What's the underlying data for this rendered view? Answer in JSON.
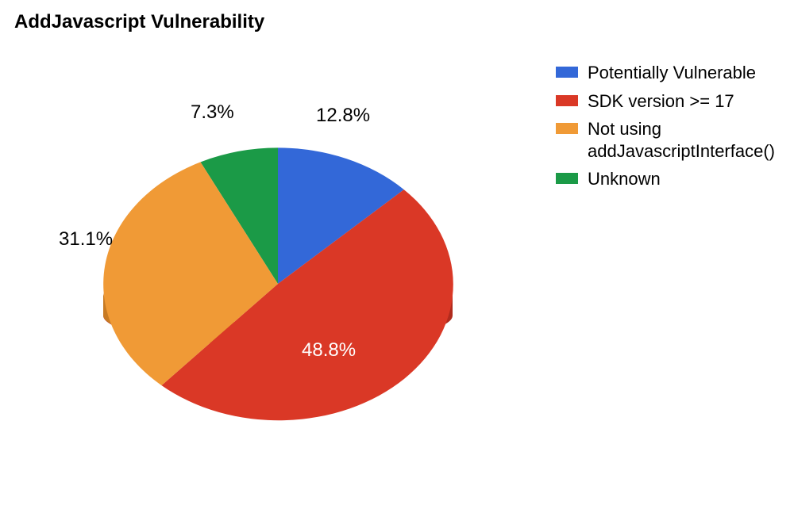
{
  "title": "AddJavascript Vulnerability",
  "legend": [
    {
      "label": "Potentially Vulnerable",
      "color": "#3368d8"
    },
    {
      "label": "SDK version >= 17",
      "color": "#da3826"
    },
    {
      "label": "Not using addJavascriptInterface()",
      "color": "#f09a36"
    },
    {
      "label": "Unknown",
      "color": "#1b9a47"
    }
  ],
  "slice_labels": {
    "potentially_vulnerable": "12.8%",
    "sdk_17": "48.8%",
    "not_using": "31.1%",
    "unknown": "7.3%"
  },
  "chart_data": {
    "type": "pie",
    "title": "AddJavascript Vulnerability",
    "categories": [
      "Potentially Vulnerable",
      "SDK version >= 17",
      "Not using addJavascriptInterface()",
      "Unknown"
    ],
    "values": [
      12.8,
      48.8,
      31.1,
      7.3
    ],
    "colors": [
      "#3368d8",
      "#da3826",
      "#f09a36",
      "#1b9a47"
    ],
    "unit": "percent",
    "start_angle_deg": 0,
    "direction": "clockwise",
    "style_3d": true
  }
}
